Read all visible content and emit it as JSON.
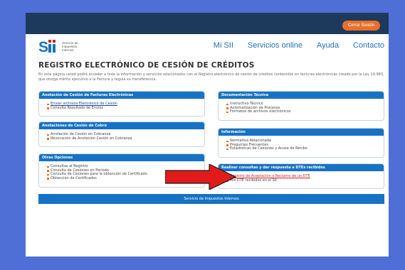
{
  "header": {
    "logout_label": "Cerrar Sesión"
  },
  "logo": {
    "line1": "Servicio de",
    "line2": "Impuestos",
    "line3": "Internos"
  },
  "nav": {
    "items": [
      "Mi SII",
      "Servicios online",
      "Ayuda",
      "Contacto"
    ]
  },
  "page": {
    "title": "REGISTRO ELECTRÓNICO DE CESIÓN DE CRÉDITOS",
    "intro": "En esta página usted podrá acceder a toda la información y servicios relacionados con el Registro electrónico de cesión de créditos contenidos en facturas electrónicas creado por la Ley 19.983, que otorga mérito ejecutivo a la Factura y regula su transferencia."
  },
  "boxes": {
    "anotacion_facturas": {
      "title": "Anotación de Cesión de Facturas Electrónicas",
      "items": [
        "Enviar archivos Electrónico de Cesión",
        "Consulta Resultado de Envíos"
      ]
    },
    "anotaciones_cobro": {
      "title": "Anotaciones de Cesión de Cobro",
      "items": [
        "Anotación de Cesión en Cobranza",
        "Revocación de Anotación Cesión en Cobranza"
      ]
    },
    "otras_opciones": {
      "title": "Otras Opciones",
      "items": [
        "Consultas al Registro",
        "Consulta de Cesiones en Período",
        "Consulta de Cesiones para la obtención de Certificado",
        "Obtención de Certificados"
      ]
    },
    "documentacion": {
      "title": "Documentación Técnica",
      "items": [
        "Instructivo Técnico",
        "Automatización de Procesos",
        "Formatos de archivos electrónicos"
      ]
    },
    "informacion": {
      "title": "Información",
      "items": [
        "Normativa Relacionada",
        "Preguntas Frecuentes",
        "Estadísticas de Cesiones y Acuse de Recibo"
      ]
    },
    "consultas_dte": {
      "title": "Realizar consultas y dar respuesta a DTEs recibidos",
      "items": [
        "Registro de Aceptación o Reclamo de un DTE",
        "Mis DTE recibidos en el SII"
      ]
    }
  },
  "footer": {
    "text": "Servicio de Impuestos Internos"
  },
  "colors": {
    "page_bg": "#4f6fd6",
    "topbar": "#1d3a5c",
    "accent": "#e8702a",
    "box_header": "#1672c4",
    "arrow": "#e11b1b"
  }
}
